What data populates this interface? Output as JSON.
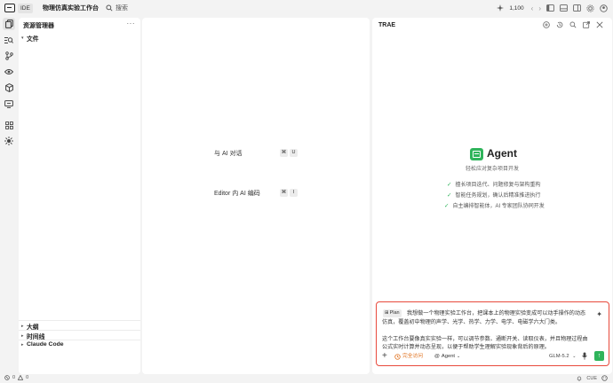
{
  "titlebar": {
    "ide_label": "IDE",
    "project_name": "物理仿真实验工作台",
    "search_label": "搜索",
    "credits": "1,100"
  },
  "explorer": {
    "title": "资源管理器",
    "more": "···",
    "files_section": "文件",
    "bottom_sections": [
      "大纲",
      "时间线",
      "Claude Code"
    ]
  },
  "editor": {
    "hints": [
      {
        "label": "与 AI 对话",
        "keys": [
          "⌘",
          "U"
        ]
      },
      {
        "label": "Editor 内 AI 编码",
        "keys": [
          "⌘",
          "I"
        ]
      }
    ]
  },
  "panel": {
    "title": "TRAE",
    "agent_name": "Agent",
    "agent_subtitle": "轻松应对复杂项目开发",
    "features": [
      "擅长项目迭代、问题修复与架构重构",
      "智能任务规划，确认后精准推进执行",
      "自主编排智能体，AI 专家团队协同开发"
    ],
    "input": {
      "badge": "Plan",
      "paragraph1": "我想做一个物理实验工作台，把课本上的物理实验变成可以动手操作的动态仿真，覆盖初中物理的声学、光学、热学、力学、电学、电磁学六大门类。",
      "paragraph2": "这个工作台要像真实实验一样，可以调节参数、通断开关、读取仪表，并且物理过程由公式实时计算并动态呈现，以便于帮助学生理解实验现象背后的原理。",
      "ask_label": "完全访问",
      "agent_label": "Agent",
      "model": "GLM-5.2"
    }
  },
  "statusbar": {
    "errors": "0",
    "warnings": "0",
    "encoding": "CUE"
  },
  "colors": {
    "accent_green": "#2fb45b",
    "input_border_red": "#e8493c",
    "ask_orange": "#e0701c"
  },
  "icons": {
    "activity": [
      "files-icon",
      "search-icon",
      "source-control-icon",
      "eye-icon",
      "extensions-box-icon",
      "remote-icon",
      "grid-icon",
      "sparkle-bug-icon"
    ]
  }
}
